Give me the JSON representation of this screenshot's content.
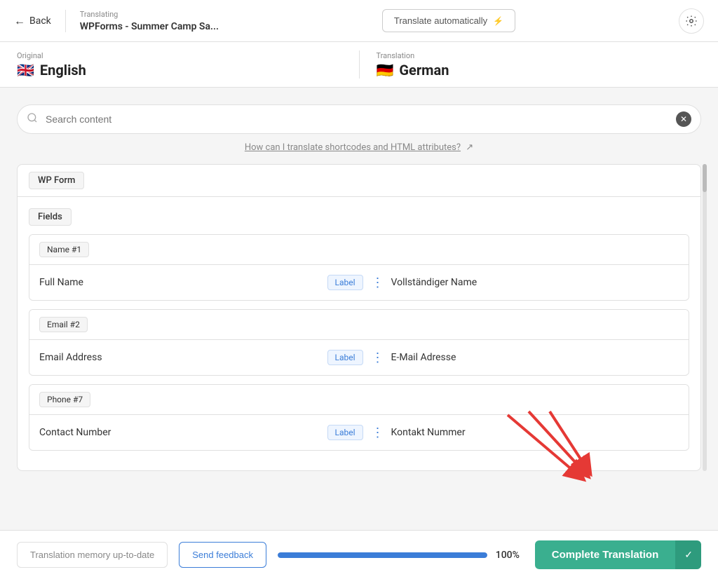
{
  "header": {
    "back_label": "Back",
    "translating_label": "Translating",
    "translating_title": "WPForms - Summer Camp Sa...",
    "translate_auto_label": "Translate automatically",
    "settings_icon": "gear-icon"
  },
  "languages": {
    "original_label": "Original",
    "original_flag": "🇬🇧",
    "original_name": "English",
    "translation_label": "Translation",
    "translation_flag": "🇩🇪",
    "translation_name": "German"
  },
  "search": {
    "placeholder": "Search content",
    "help_link": "How can I translate shortcodes and HTML attributes?"
  },
  "content": {
    "card_title": "WP Form",
    "fields_section": "Fields",
    "field_groups": [
      {
        "group_name": "Name #1",
        "fields": [
          {
            "original": "Full Name",
            "label": "Label",
            "translation": "Vollständiger Name"
          }
        ]
      },
      {
        "group_name": "Email #2",
        "fields": [
          {
            "original": "Email Address",
            "label": "Label",
            "translation": "E-Mail Adresse"
          }
        ]
      },
      {
        "group_name": "Phone #7",
        "fields": [
          {
            "original": "Contact Number",
            "label": "Label",
            "translation": "Kontakt Nummer"
          }
        ]
      }
    ]
  },
  "bottom_bar": {
    "memory_btn_label": "Translation memory up-to-date",
    "feedback_btn_label": "Send feedback",
    "progress_percent": "100%",
    "progress_value": 100,
    "complete_btn_label": "Complete Translation",
    "chevron": "✓"
  }
}
